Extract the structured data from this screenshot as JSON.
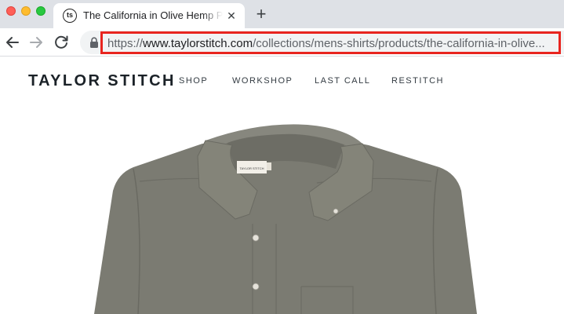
{
  "browser": {
    "tab": {
      "favicon_text": "ts",
      "title": "The California in Olive Hemp P..."
    },
    "address_bar": {
      "url_scheme": "https://",
      "url_host": "www.taylorstitch.com",
      "url_path": "/collections/mens-shirts/products/the-california-in-olive..."
    }
  },
  "site": {
    "logo": "TAYLOR STITCH",
    "nav": [
      "SHOP",
      "WORKSHOP",
      "LAST CALL",
      "RESTITCH"
    ]
  },
  "product": {
    "label_text": "TAYLOR STITCH",
    "colors": {
      "shirt": "#7b7b72",
      "shirt_shadow": "#66665e",
      "highlight": "#e8251f"
    }
  },
  "icons": {
    "back": "arrow-left-icon",
    "forward": "arrow-right-icon",
    "reload": "reload-icon",
    "lock": "lock-icon",
    "close": "close-icon",
    "new_tab": "plus-icon"
  }
}
